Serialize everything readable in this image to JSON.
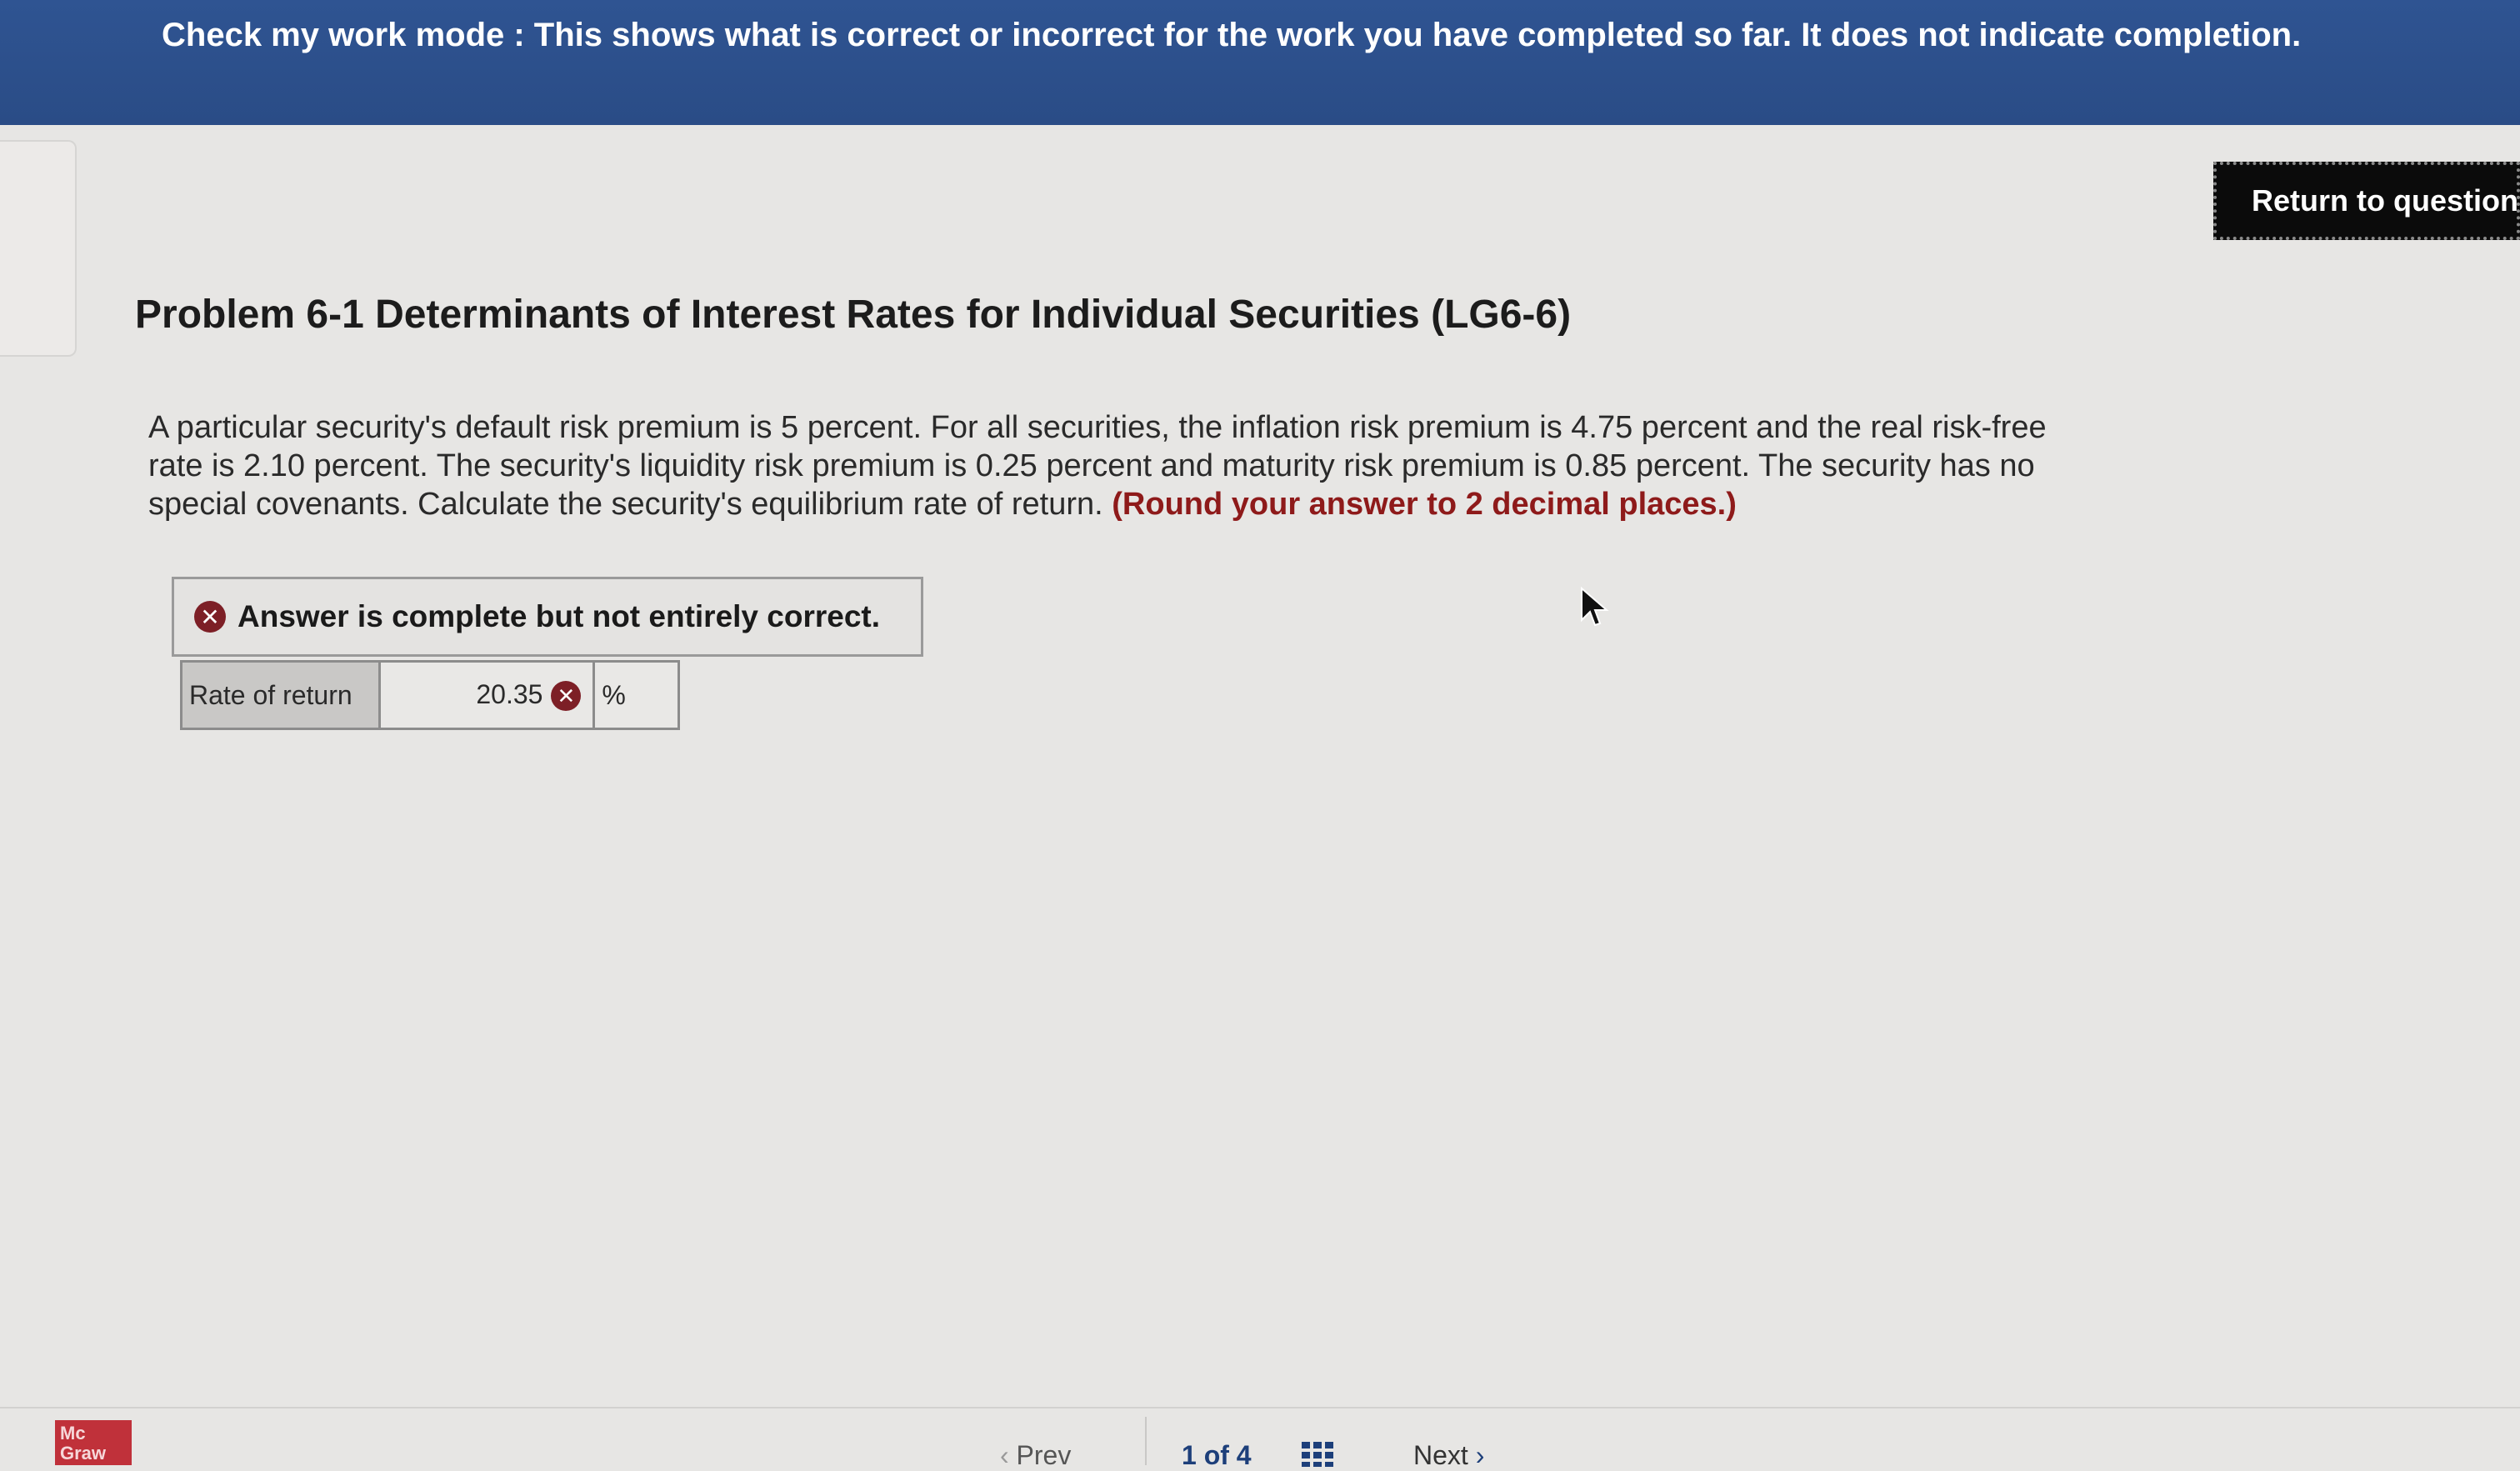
{
  "banner": {
    "text": "Check my work mode : This shows what is correct or incorrect for the work you have completed so far. It does not indicate completion."
  },
  "return_button": {
    "label": "Return to question"
  },
  "problem": {
    "title": "Problem 6-1 Determinants of Interest Rates for Individual Securities (LG6-6)",
    "body": "A particular security's default risk premium is 5 percent. For all securities, the inflation risk premium is 4.75 percent and the real risk-free rate is 2.10 percent. The security's liquidity risk premium is 0.25 percent and maturity risk premium is 0.85 percent. The security has no special covenants. Calculate the security's equilibrium rate of return. ",
    "hint": "(Round your answer to 2 decimal places.)"
  },
  "answer": {
    "status": "Answer is complete but not entirely correct.",
    "status_icon": "x-circle-icon",
    "row_label": "Rate of return",
    "value": "20.35",
    "unit": "%"
  },
  "footer": {
    "logo_line1": "Mc",
    "logo_line2": "Graw",
    "prev_label": "Prev",
    "page_indicator": "1 of 4",
    "next_label": "Next"
  },
  "colors": {
    "banner": "#2f5492",
    "incorrect": "#7d1f26",
    "hint": "#8e1a1a"
  }
}
